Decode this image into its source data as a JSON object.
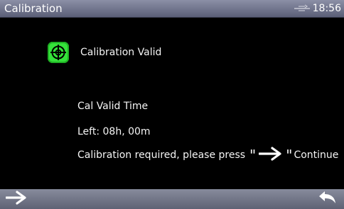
{
  "titlebar": {
    "title": "Calibration",
    "clock": "18:56",
    "status_icon": "connection-icon"
  },
  "main": {
    "status_label": "Calibration Valid",
    "status_icon": "target-crosshair-icon",
    "status_color": "#35e23a",
    "valid_time_label": "Cal Valid Time",
    "time_left": "Left: 08h, 00m",
    "instruction_prefix": "Calibration required, please press",
    "quote_open": "\"",
    "quote_close": "\"",
    "instruction_suffix": "Continue",
    "instruction_icon": "arrow-right-icon"
  },
  "bottombar": {
    "continue_icon": "arrow-right-icon",
    "back_icon": "return-arrow-icon"
  }
}
